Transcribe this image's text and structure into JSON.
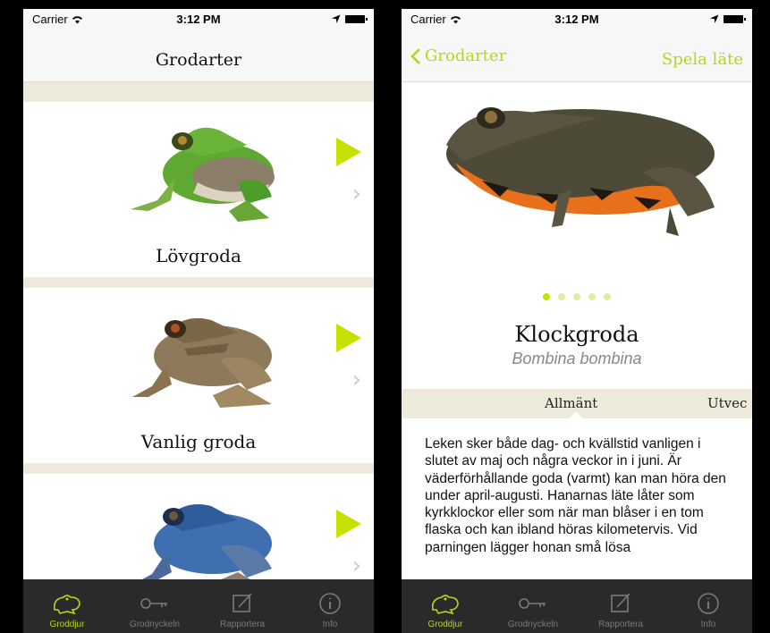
{
  "status": {
    "carrier": "Carrier",
    "time": "3:12 PM"
  },
  "left": {
    "title": "Grodarter",
    "species": [
      {
        "name": "Lövgroda"
      },
      {
        "name": "Vanlig groda"
      },
      {
        "name": ""
      }
    ]
  },
  "right": {
    "back": "Grodarter",
    "action": "Spela läte",
    "name": "Klockgroda",
    "latin": "Bombina bombina",
    "page_count": 5,
    "page_active": 0,
    "tabs": [
      "Allmänt",
      "Utvec"
    ],
    "text": "Leken sker både dag- och kvällstid vanligen i slutet av maj och några veckor in i juni. Är väderförhållande goda (varmt) kan man höra den under april-augusti. Hanarnas läte låter som kyrkklockor eller som när man blåser i en tom flaska och kan ibland höras kilometervis. Vid parningen lägger honan små lösa"
  },
  "tabbar": [
    {
      "label": "Groddjur",
      "icon": "frog-icon",
      "active": true
    },
    {
      "label": "Grodnyckeln",
      "icon": "key-icon",
      "active": false
    },
    {
      "label": "Rapportera",
      "icon": "edit-icon",
      "active": false
    },
    {
      "label": "Info",
      "icon": "info-icon",
      "active": false
    }
  ],
  "colors": {
    "accent": "#c8e000",
    "accent_text": "#b9d41c",
    "beige": "#eeeadb",
    "tabbar": "#2a2a2a"
  }
}
